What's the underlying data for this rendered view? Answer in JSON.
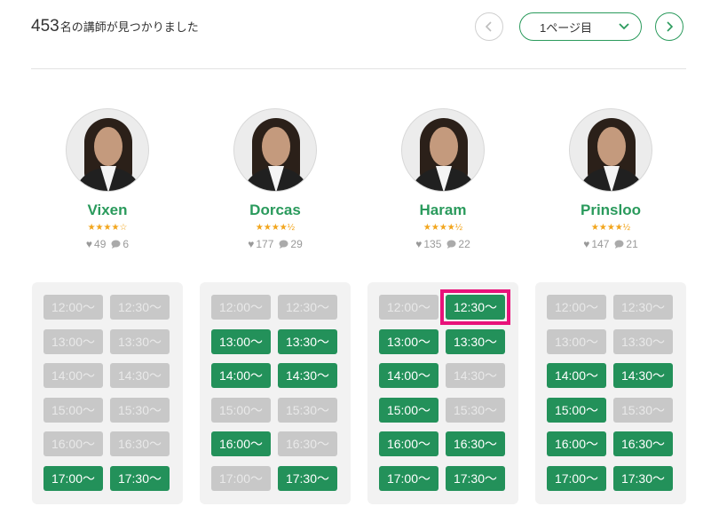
{
  "header": {
    "count": "453",
    "count_suffix": "名の講師が見つかりました",
    "page_select": "1ページ目",
    "prev_icon": "chevron-left-icon",
    "next_icon": "chevron-right-icon",
    "dropdown_icon": "chevron-down-icon"
  },
  "colors": {
    "accent": "#2a9a5c",
    "slot_on": "#23915a",
    "slot_off": "#c8c8c8",
    "star": "#f2a51c",
    "highlight": "#e8127a"
  },
  "teachers": [
    {
      "name": "Vixen",
      "stars": "★★★★☆",
      "rating": 4,
      "likes": "49",
      "reviews": "6",
      "slots": [
        {
          "label": "12:00〜",
          "available": false
        },
        {
          "label": "12:30〜",
          "available": false
        },
        {
          "label": "13:00〜",
          "available": false
        },
        {
          "label": "13:30〜",
          "available": false
        },
        {
          "label": "14:00〜",
          "available": false
        },
        {
          "label": "14:30〜",
          "available": false
        },
        {
          "label": "15:00〜",
          "available": false
        },
        {
          "label": "15:30〜",
          "available": false
        },
        {
          "label": "16:00〜",
          "available": false
        },
        {
          "label": "16:30〜",
          "available": false
        },
        {
          "label": "17:00〜",
          "available": true
        },
        {
          "label": "17:30〜",
          "available": true
        }
      ]
    },
    {
      "name": "Dorcas",
      "stars": "★★★★½",
      "rating": 4.5,
      "likes": "177",
      "reviews": "29",
      "slots": [
        {
          "label": "12:00〜",
          "available": false
        },
        {
          "label": "12:30〜",
          "available": false
        },
        {
          "label": "13:00〜",
          "available": true
        },
        {
          "label": "13:30〜",
          "available": true
        },
        {
          "label": "14:00〜",
          "available": true
        },
        {
          "label": "14:30〜",
          "available": true
        },
        {
          "label": "15:00〜",
          "available": false
        },
        {
          "label": "15:30〜",
          "available": false
        },
        {
          "label": "16:00〜",
          "available": true
        },
        {
          "label": "16:30〜",
          "available": false
        },
        {
          "label": "17:00〜",
          "available": false
        },
        {
          "label": "17:30〜",
          "available": true
        }
      ]
    },
    {
      "name": "Haram",
      "stars": "★★★★½",
      "rating": 4.5,
      "likes": "135",
      "reviews": "22",
      "slots": [
        {
          "label": "12:00〜",
          "available": false
        },
        {
          "label": "12:30〜",
          "available": true,
          "highlighted": true
        },
        {
          "label": "13:00〜",
          "available": true
        },
        {
          "label": "13:30〜",
          "available": true
        },
        {
          "label": "14:00〜",
          "available": true
        },
        {
          "label": "14:30〜",
          "available": false
        },
        {
          "label": "15:00〜",
          "available": true
        },
        {
          "label": "15:30〜",
          "available": false
        },
        {
          "label": "16:00〜",
          "available": true
        },
        {
          "label": "16:30〜",
          "available": true
        },
        {
          "label": "17:00〜",
          "available": true
        },
        {
          "label": "17:30〜",
          "available": true
        }
      ]
    },
    {
      "name": "Prinsloo",
      "stars": "★★★★½",
      "rating": 4.5,
      "likes": "147",
      "reviews": "21",
      "slots": [
        {
          "label": "12:00〜",
          "available": false
        },
        {
          "label": "12:30〜",
          "available": false
        },
        {
          "label": "13:00〜",
          "available": false
        },
        {
          "label": "13:30〜",
          "available": false
        },
        {
          "label": "14:00〜",
          "available": true
        },
        {
          "label": "14:30〜",
          "available": true
        },
        {
          "label": "15:00〜",
          "available": true
        },
        {
          "label": "15:30〜",
          "available": false
        },
        {
          "label": "16:00〜",
          "available": true
        },
        {
          "label": "16:30〜",
          "available": true
        },
        {
          "label": "17:00〜",
          "available": true
        },
        {
          "label": "17:30〜",
          "available": true
        }
      ]
    }
  ]
}
